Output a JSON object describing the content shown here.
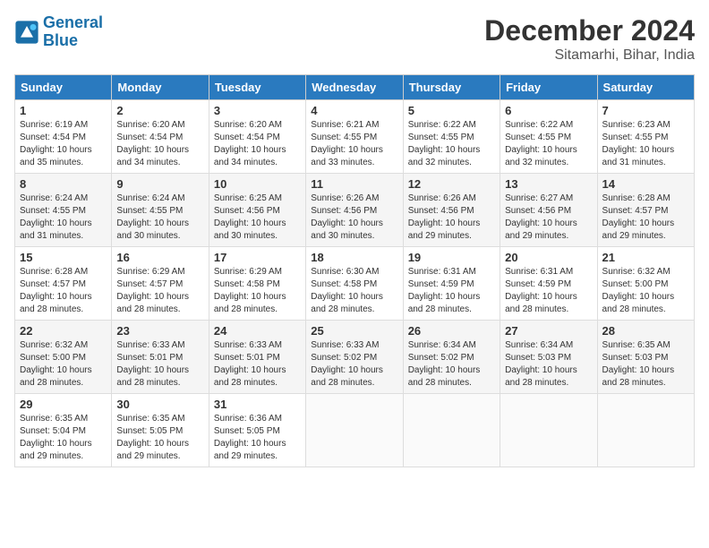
{
  "header": {
    "logo_line1": "General",
    "logo_line2": "Blue",
    "month_year": "December 2024",
    "location": "Sitamarhi, Bihar, India"
  },
  "weekdays": [
    "Sunday",
    "Monday",
    "Tuesday",
    "Wednesday",
    "Thursday",
    "Friday",
    "Saturday"
  ],
  "weeks": [
    [
      {
        "day": "1",
        "info": "Sunrise: 6:19 AM\nSunset: 4:54 PM\nDaylight: 10 hours\nand 35 minutes."
      },
      {
        "day": "2",
        "info": "Sunrise: 6:20 AM\nSunset: 4:54 PM\nDaylight: 10 hours\nand 34 minutes."
      },
      {
        "day": "3",
        "info": "Sunrise: 6:20 AM\nSunset: 4:54 PM\nDaylight: 10 hours\nand 34 minutes."
      },
      {
        "day": "4",
        "info": "Sunrise: 6:21 AM\nSunset: 4:55 PM\nDaylight: 10 hours\nand 33 minutes."
      },
      {
        "day": "5",
        "info": "Sunrise: 6:22 AM\nSunset: 4:55 PM\nDaylight: 10 hours\nand 32 minutes."
      },
      {
        "day": "6",
        "info": "Sunrise: 6:22 AM\nSunset: 4:55 PM\nDaylight: 10 hours\nand 32 minutes."
      },
      {
        "day": "7",
        "info": "Sunrise: 6:23 AM\nSunset: 4:55 PM\nDaylight: 10 hours\nand 31 minutes."
      }
    ],
    [
      {
        "day": "8",
        "info": "Sunrise: 6:24 AM\nSunset: 4:55 PM\nDaylight: 10 hours\nand 31 minutes."
      },
      {
        "day": "9",
        "info": "Sunrise: 6:24 AM\nSunset: 4:55 PM\nDaylight: 10 hours\nand 30 minutes."
      },
      {
        "day": "10",
        "info": "Sunrise: 6:25 AM\nSunset: 4:56 PM\nDaylight: 10 hours\nand 30 minutes."
      },
      {
        "day": "11",
        "info": "Sunrise: 6:26 AM\nSunset: 4:56 PM\nDaylight: 10 hours\nand 30 minutes."
      },
      {
        "day": "12",
        "info": "Sunrise: 6:26 AM\nSunset: 4:56 PM\nDaylight: 10 hours\nand 29 minutes."
      },
      {
        "day": "13",
        "info": "Sunrise: 6:27 AM\nSunset: 4:56 PM\nDaylight: 10 hours\nand 29 minutes."
      },
      {
        "day": "14",
        "info": "Sunrise: 6:28 AM\nSunset: 4:57 PM\nDaylight: 10 hours\nand 29 minutes."
      }
    ],
    [
      {
        "day": "15",
        "info": "Sunrise: 6:28 AM\nSunset: 4:57 PM\nDaylight: 10 hours\nand 28 minutes."
      },
      {
        "day": "16",
        "info": "Sunrise: 6:29 AM\nSunset: 4:57 PM\nDaylight: 10 hours\nand 28 minutes."
      },
      {
        "day": "17",
        "info": "Sunrise: 6:29 AM\nSunset: 4:58 PM\nDaylight: 10 hours\nand 28 minutes."
      },
      {
        "day": "18",
        "info": "Sunrise: 6:30 AM\nSunset: 4:58 PM\nDaylight: 10 hours\nand 28 minutes."
      },
      {
        "day": "19",
        "info": "Sunrise: 6:31 AM\nSunset: 4:59 PM\nDaylight: 10 hours\nand 28 minutes."
      },
      {
        "day": "20",
        "info": "Sunrise: 6:31 AM\nSunset: 4:59 PM\nDaylight: 10 hours\nand 28 minutes."
      },
      {
        "day": "21",
        "info": "Sunrise: 6:32 AM\nSunset: 5:00 PM\nDaylight: 10 hours\nand 28 minutes."
      }
    ],
    [
      {
        "day": "22",
        "info": "Sunrise: 6:32 AM\nSunset: 5:00 PM\nDaylight: 10 hours\nand 28 minutes."
      },
      {
        "day": "23",
        "info": "Sunrise: 6:33 AM\nSunset: 5:01 PM\nDaylight: 10 hours\nand 28 minutes."
      },
      {
        "day": "24",
        "info": "Sunrise: 6:33 AM\nSunset: 5:01 PM\nDaylight: 10 hours\nand 28 minutes."
      },
      {
        "day": "25",
        "info": "Sunrise: 6:33 AM\nSunset: 5:02 PM\nDaylight: 10 hours\nand 28 minutes."
      },
      {
        "day": "26",
        "info": "Sunrise: 6:34 AM\nSunset: 5:02 PM\nDaylight: 10 hours\nand 28 minutes."
      },
      {
        "day": "27",
        "info": "Sunrise: 6:34 AM\nSunset: 5:03 PM\nDaylight: 10 hours\nand 28 minutes."
      },
      {
        "day": "28",
        "info": "Sunrise: 6:35 AM\nSunset: 5:03 PM\nDaylight: 10 hours\nand 28 minutes."
      }
    ],
    [
      {
        "day": "29",
        "info": "Sunrise: 6:35 AM\nSunset: 5:04 PM\nDaylight: 10 hours\nand 29 minutes."
      },
      {
        "day": "30",
        "info": "Sunrise: 6:35 AM\nSunset: 5:05 PM\nDaylight: 10 hours\nand 29 minutes."
      },
      {
        "day": "31",
        "info": "Sunrise: 6:36 AM\nSunset: 5:05 PM\nDaylight: 10 hours\nand 29 minutes."
      },
      {
        "day": "",
        "info": ""
      },
      {
        "day": "",
        "info": ""
      },
      {
        "day": "",
        "info": ""
      },
      {
        "day": "",
        "info": ""
      }
    ]
  ]
}
